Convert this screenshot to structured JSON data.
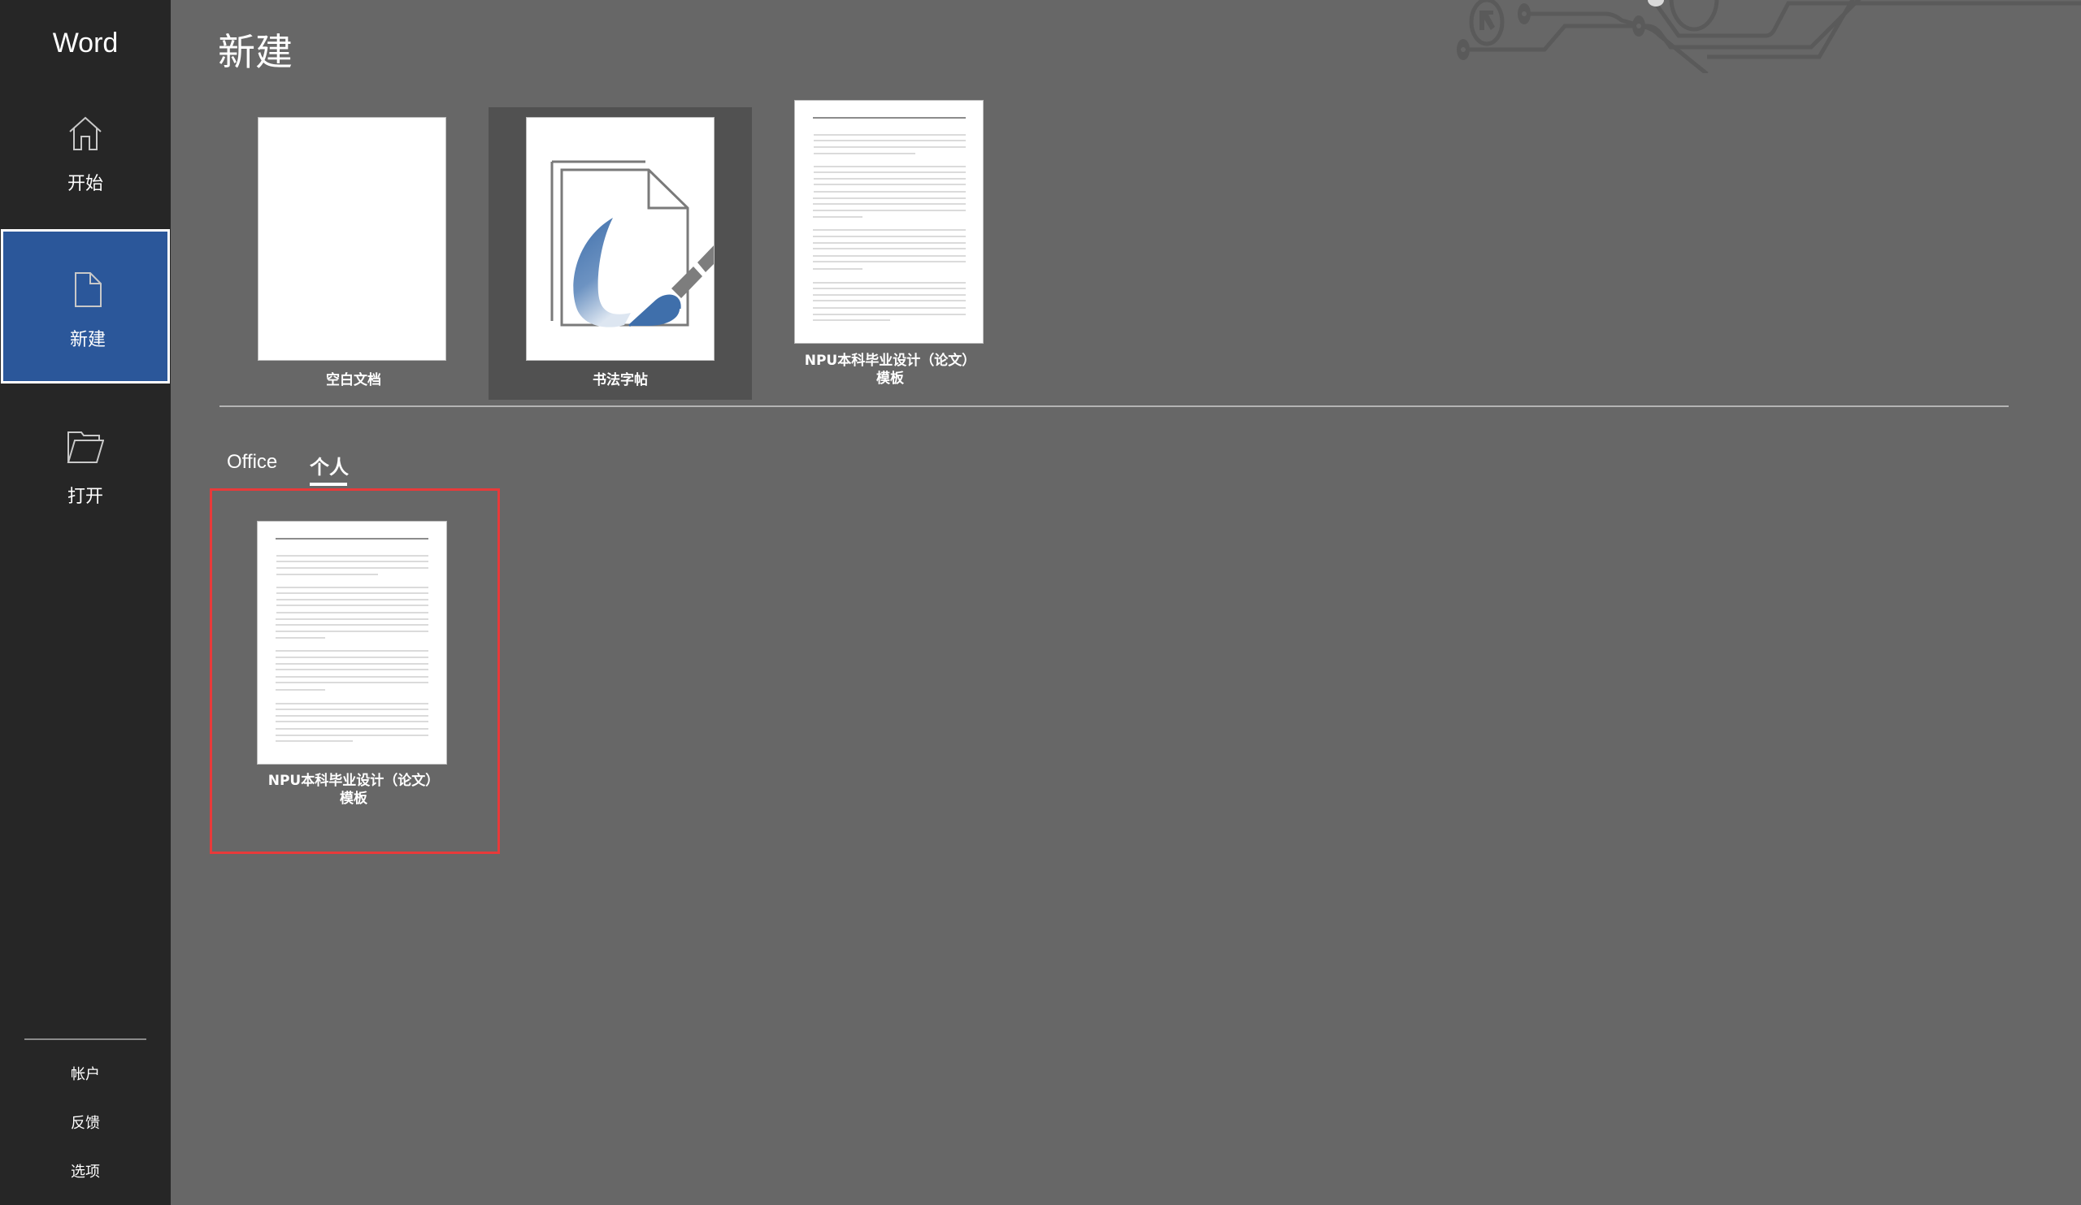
{
  "app": {
    "title": "Word"
  },
  "sidebar": {
    "items": [
      {
        "label": "开始",
        "icon": "home-icon",
        "selected": false
      },
      {
        "label": "新建",
        "icon": "new-document-icon",
        "selected": true
      },
      {
        "label": "打开",
        "icon": "folder-open-icon",
        "selected": false
      }
    ],
    "bottom_links": [
      {
        "label": "帐户"
      },
      {
        "label": "反馈"
      },
      {
        "label": "选项"
      }
    ]
  },
  "main": {
    "title": "新建",
    "featured_templates": [
      {
        "label": "空白文档",
        "thumbnail": "blank-page",
        "selected": false
      },
      {
        "label": "书法字帖",
        "thumbnail": "calligraphy-brush",
        "selected": true
      },
      {
        "label_line1": "NPU本科毕业设计（论文）",
        "label_line2": "模板",
        "thumbnail": "lined-document",
        "selected": false
      }
    ],
    "tabs": [
      {
        "label": "Office",
        "active": false
      },
      {
        "label": "个人",
        "active": true
      }
    ],
    "personal_templates": [
      {
        "label_line1": "NPU本科毕业设计（论文）",
        "label_line2": "模板",
        "thumbnail": "lined-document",
        "highlighted": true
      }
    ]
  },
  "colors": {
    "sidebar_bg": "#262626",
    "selected_nav": "#2b579a",
    "content_bg": "#676767",
    "selected_card": "#515151",
    "highlight_border": "#e83a3a"
  }
}
